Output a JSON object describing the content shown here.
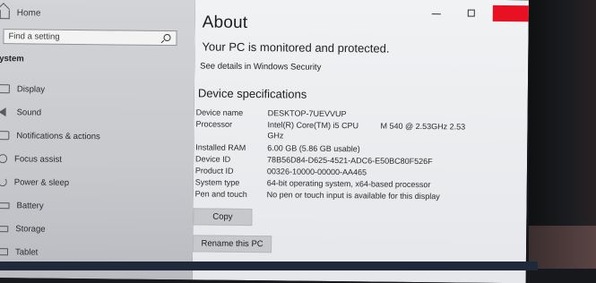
{
  "sidebar": {
    "home_label": "Home",
    "search_placeholder": "Find a setting",
    "section_label": "ystem",
    "items": [
      {
        "label": "Display",
        "icon": "display-icon"
      },
      {
        "label": "Sound",
        "icon": "sound-icon"
      },
      {
        "label": "Notifications & actions",
        "icon": "notifications-icon"
      },
      {
        "label": "Focus assist",
        "icon": "focus-assist-icon"
      },
      {
        "label": "Power & sleep",
        "icon": "power-icon"
      },
      {
        "label": "Battery",
        "icon": "battery-icon"
      },
      {
        "label": "Storage",
        "icon": "storage-icon"
      },
      {
        "label": "Tablet",
        "icon": "tablet-icon"
      }
    ]
  },
  "main": {
    "title": "About",
    "security_message": "Your PC is monitored and protected.",
    "security_link": "See details in Windows Security",
    "spec_title": "Device specifications",
    "specs": {
      "device_name_label": "Device name",
      "device_name": "DESKTOP-7UEVVUP",
      "processor_label": "Processor",
      "processor_line1": "Intel(R) Core(TM) i5 CPU",
      "processor_extra": "M 540  @ 2.53GHz   2.53",
      "processor_line2": "GHz",
      "ram_label": "Installed RAM",
      "ram": "6.00 GB (5.86 GB usable)",
      "device_id_label": "Device ID",
      "device_id": "78B56D84-D625-4521-ADC6-E50BC80F526F",
      "product_id_label": "Product ID",
      "product_id": "00326-10000-00000-AA465",
      "system_type_label": "System type",
      "system_type": "64-bit operating system, x64-based processor",
      "pen_label": "Pen and touch",
      "pen": "No pen or touch input is available for this display"
    },
    "copy_button": "Copy",
    "rename_button": "Rename this PC"
  },
  "colors": {
    "close_button": "#e81123",
    "sidebar_bg": "#cfd1d5",
    "main_bg": "#eeeff1"
  }
}
